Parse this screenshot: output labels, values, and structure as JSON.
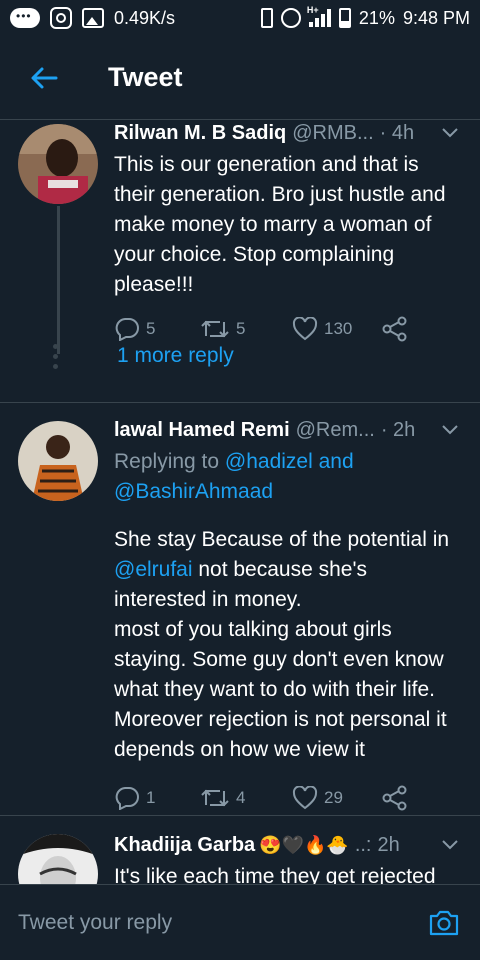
{
  "status_bar": {
    "speed": "0.49K/s",
    "network_label": "H+",
    "battery": "21%",
    "time": "9:48 PM"
  },
  "header": {
    "title": "Tweet"
  },
  "tweets": [
    {
      "name": "Rilwan M. B Sadiq",
      "handle": "@RMB...",
      "time": "· 4h",
      "body": "This is our generation and that is their generation. Bro just hustle and make money to marry a woman of your choice. Stop complaining please!!!",
      "replies": "5",
      "retweets": "5",
      "likes": "130"
    },
    {
      "name": "lawal Hamed Remi",
      "handle": "@Rem...",
      "time": "· 2h",
      "replying_prefix": "Replying to",
      "replying_mention_1": "@hadizel and",
      "replying_mention_2": "@BashirAhmaad",
      "body_line_1_pre": "She stay Because of the potential in",
      "body_mention": "@elrufai",
      "body_line_2_post": " not because she's interested in money.",
      "body_rest": "most of you talking about girls staying. Some guy don't even know what they want to do with their life. Moreover rejection is not personal it depends on how we view it",
      "replies": "1",
      "retweets": "4",
      "likes": "29"
    },
    {
      "name": "Khadiija Garba",
      "name_emoji": "😍🖤🔥🐣",
      "handle": "..:",
      "time": "2h",
      "body": "It's like each time they get rejected"
    }
  ],
  "more_reply": "1 more reply",
  "reply_bar": {
    "placeholder": "Tweet your reply"
  },
  "colors": {
    "background": "#15202b",
    "accent": "#1da1f2",
    "muted": "#8899a6",
    "divider": "#38444d"
  }
}
